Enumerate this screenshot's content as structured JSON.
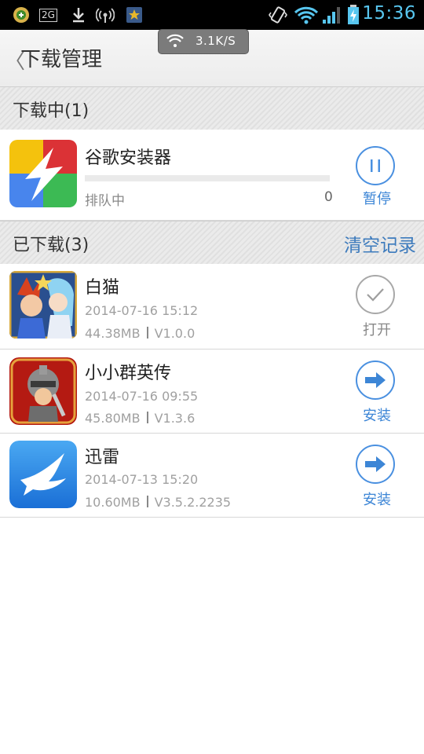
{
  "status_bar": {
    "time": "15:36",
    "network_badge": "2G",
    "speed_indicator": "3.1K/S",
    "icons": [
      "app-badge-icon",
      "network-2g-icon",
      "download-icon",
      "wireless-icon",
      "shield-star-icon",
      "vibrate-icon",
      "wifi-icon",
      "signal-icon",
      "battery-charging-icon"
    ]
  },
  "header": {
    "back_glyph": "〈",
    "title": "下载管理"
  },
  "downloading": {
    "section_label": "下载中(1)",
    "items": [
      {
        "name": "谷歌安装器",
        "status": "排队中",
        "count": "0",
        "progress": 0,
        "button_label": "暂停",
        "icon": "google-installer-icon"
      }
    ]
  },
  "downloaded": {
    "section_label": "已下载(3)",
    "clear_label": "清空记录",
    "items": [
      {
        "name": "白猫",
        "date": "2014-07-16 15:12",
        "size": "44.38MB",
        "version": "V1.0.0",
        "button_label": "打开",
        "icon": "white-cat-game-icon"
      },
      {
        "name": "小小群英传",
        "date": "2014-07-16 09:55",
        "size": "45.80MB",
        "version": "V1.3.6",
        "button_label": "安装",
        "icon": "knight-game-icon"
      },
      {
        "name": "迅雷",
        "date": "2014-07-13 15:20",
        "size": "10.60MB",
        "version": "V3.5.2.2235",
        "button_label": "安装",
        "icon": "xunlei-bird-icon"
      }
    ]
  },
  "colors": {
    "accent": "#3d86d6",
    "status_time": "#58c6ef",
    "open_gray": "#a8a8a8"
  }
}
